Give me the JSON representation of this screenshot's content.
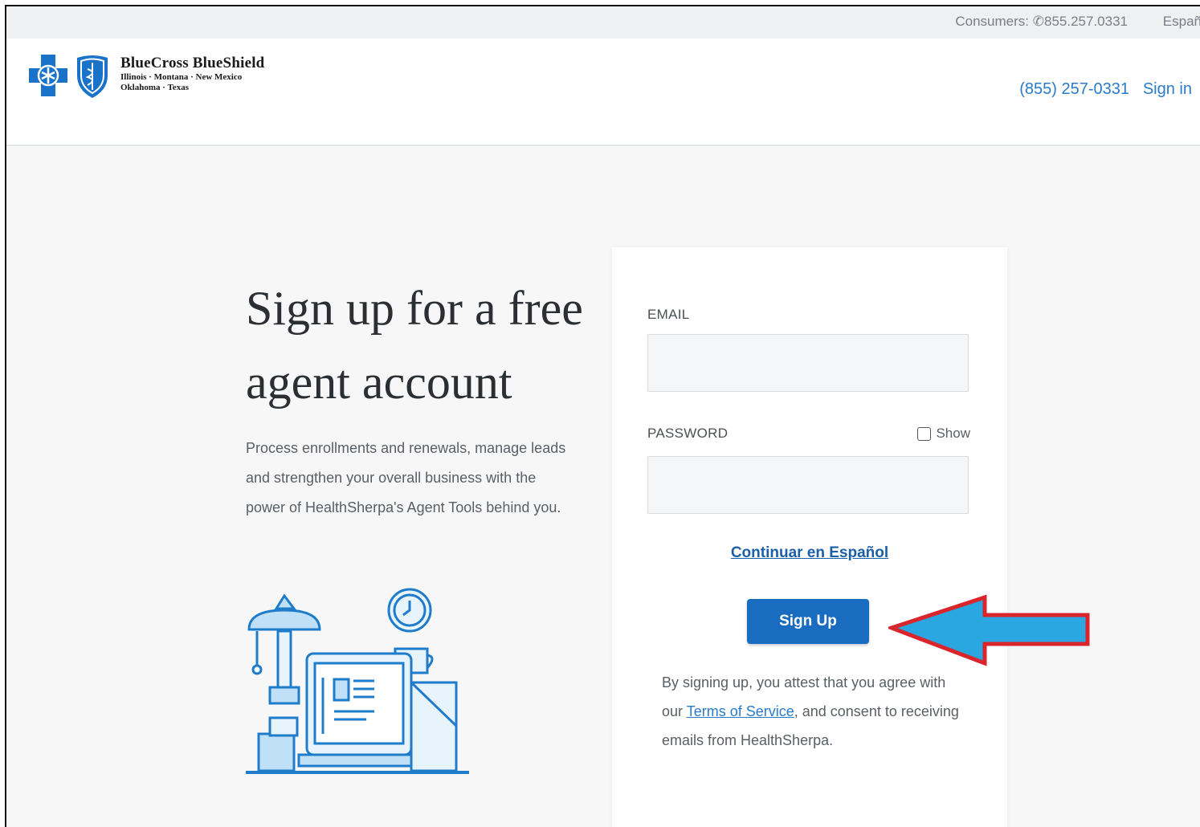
{
  "topbar": {
    "consumers_label": "Consumers:",
    "consumers_phone": "855.257.0331",
    "espanol": "Españ"
  },
  "header": {
    "brand": "BlueCross BlueShield",
    "states_line1": "Illinois · Montana · New Mexico",
    "states_line2": "Oklahoma · Texas",
    "phone": "(855) 257-0331",
    "signin": "Sign in"
  },
  "main": {
    "headline_line1": "Sign up for a free",
    "headline_line2": "agent account",
    "description": "Process enrollments and renewals, manage leads and strengthen your overall business with the power of HealthSherpa's Agent Tools behind you."
  },
  "form": {
    "email_label": "EMAIL",
    "email_value": "",
    "password_label": "PASSWORD",
    "password_value": "",
    "show_label": "Show",
    "spanish_link": "Continuar en Español",
    "signup_button": "Sign Up",
    "terms_prefix": "By signing up, you attest that you agree with our",
    "terms_link": "Terms of Service",
    "terms_suffix": ", and consent to receiving emails from HealthSherpa."
  },
  "colors": {
    "brand_blue": "#1a6cc0",
    "link_blue": "#2a7bc7",
    "annotation_red": "#d9262c",
    "annotation_blue": "#2aa6e0"
  },
  "icons": [
    "phone-icon",
    "bluecross-logo-icon",
    "blueshield-logo-icon",
    "checkbox-icon",
    "annotation-arrow-icon",
    "desk-illustration-icon"
  ]
}
